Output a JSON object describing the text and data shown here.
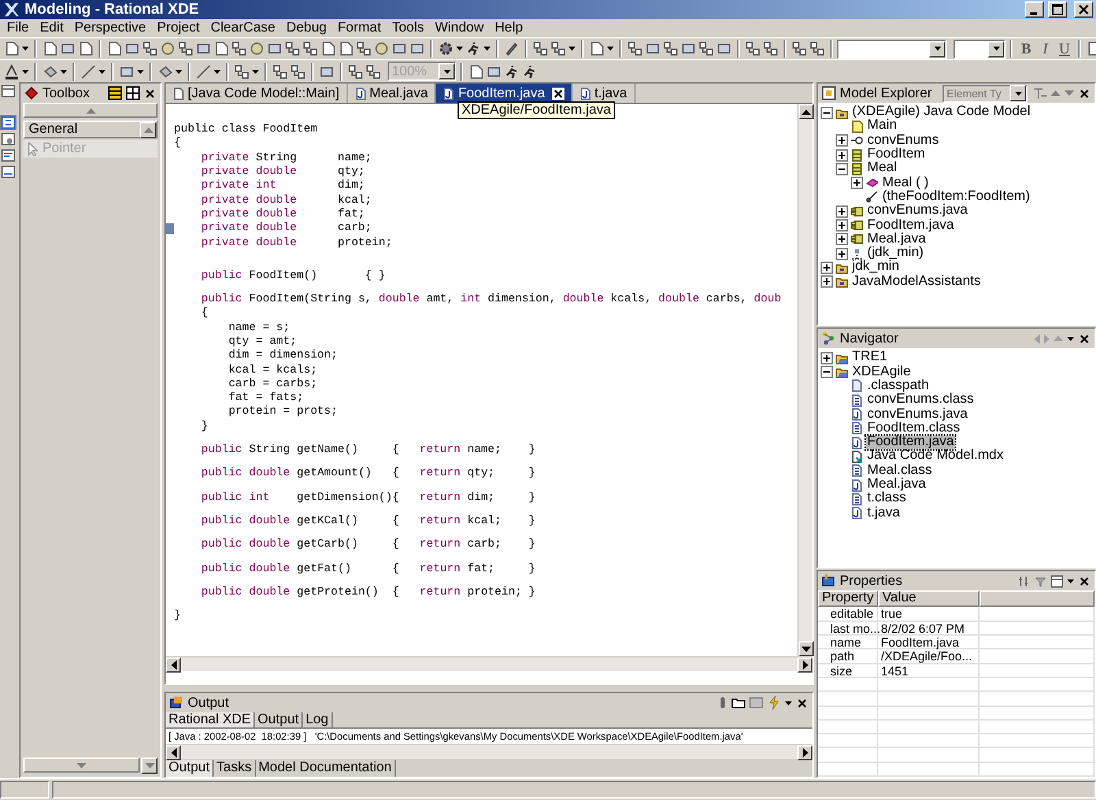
{
  "window": {
    "title": "Modeling - Rational XDE"
  },
  "menu": [
    "File",
    "Edit",
    "Perspective",
    "Project",
    "ClearCase",
    "Debug",
    "Format",
    "Tools",
    "Window",
    "Help"
  ],
  "toolbar": {
    "format_buttons": [
      "B",
      "I",
      "U"
    ],
    "zoom_combo": {
      "value": "100%",
      "disabled": true
    }
  },
  "toolbox": {
    "title": "Toolbox",
    "drawer": "General",
    "items": [
      {
        "label": "Pointer",
        "disabled": true
      }
    ]
  },
  "editor": {
    "tabs": [
      {
        "label": "[Java Code Model::Main]",
        "kind": "model",
        "selected": false
      },
      {
        "label": "Meal.java",
        "kind": "java",
        "selected": false
      },
      {
        "label": "FoodItem.java",
        "kind": "java",
        "selected": true
      },
      {
        "label": "t.java",
        "kind": "java",
        "selected": false
      }
    ],
    "tooltip": "XDEAgile/FoodItem.java",
    "lines": [
      {
        "bookmarked": false,
        "tokens": [
          {
            "kind": "plain",
            "text": "public class FoodItem"
          }
        ]
      },
      {
        "bookmarked": false,
        "tokens": [
          {
            "kind": "plain",
            "text": "{"
          }
        ]
      },
      {
        "bookmarked": false,
        "tokens": [
          {
            "kind": "keyword",
            "text": "    private"
          },
          {
            "kind": "plain",
            "text": " String      name;"
          }
        ]
      },
      {
        "bookmarked": false,
        "tokens": [
          {
            "kind": "keyword",
            "text": "    private double"
          },
          {
            "kind": "plain",
            "text": "      qty;"
          }
        ]
      },
      {
        "bookmarked": false,
        "tokens": [
          {
            "kind": "keyword",
            "text": "    private int"
          },
          {
            "kind": "plain",
            "text": "         dim;"
          }
        ]
      },
      {
        "bookmarked": false,
        "tokens": [
          {
            "kind": "keyword",
            "text": "    private double"
          },
          {
            "kind": "plain",
            "text": "      kcal;"
          }
        ]
      },
      {
        "bookmarked": false,
        "tokens": [
          {
            "kind": "keyword",
            "text": "    private double"
          },
          {
            "kind": "plain",
            "text": "      fat;"
          }
        ]
      },
      {
        "bookmarked": true,
        "tokens": [
          {
            "kind": "keyword",
            "text": "    private double"
          },
          {
            "kind": "plain",
            "text": "      carb;"
          }
        ]
      },
      {
        "bookmarked": false,
        "tokens": [
          {
            "kind": "keyword",
            "text": "    private double"
          },
          {
            "kind": "plain",
            "text": "      protein;"
          }
        ]
      },
      {
        "bookmarked": false
      },
      {
        "bookmarked": false
      },
      {
        "bookmarked": false,
        "tokens": [
          {
            "kind": "keyword",
            "text": "    public"
          },
          {
            "kind": "plain",
            "text": " FoodItem()       { }"
          }
        ]
      },
      {
        "bookmarked": false
      },
      {
        "bookmarked": false,
        "tokens": [
          {
            "kind": "keyword",
            "text": "    public"
          },
          {
            "kind": "plain",
            "text": " FoodItem(String s, "
          },
          {
            "kind": "keyword",
            "text": "double"
          },
          {
            "kind": "plain",
            "text": " amt, "
          },
          {
            "kind": "keyword",
            "text": "int"
          },
          {
            "kind": "plain",
            "text": " dimension, "
          },
          {
            "kind": "keyword",
            "text": "double"
          },
          {
            "kind": "plain",
            "text": " kcals, "
          },
          {
            "kind": "keyword",
            "text": "double"
          },
          {
            "kind": "plain",
            "text": " carbs, "
          },
          {
            "kind": "keyword",
            "text": "doub"
          }
        ]
      },
      {
        "bookmarked": false,
        "tokens": [
          {
            "kind": "plain",
            "text": "    {"
          }
        ]
      },
      {
        "bookmarked": false,
        "tokens": [
          {
            "kind": "plain",
            "text": "        name = s;"
          }
        ]
      },
      {
        "bookmarked": false,
        "tokens": [
          {
            "kind": "plain",
            "text": "        qty = amt;"
          }
        ]
      },
      {
        "bookmarked": false,
        "tokens": [
          {
            "kind": "plain",
            "text": "        dim = dimension;"
          }
        ]
      },
      {
        "bookmarked": false,
        "tokens": [
          {
            "kind": "plain",
            "text": "        kcal = kcals;"
          }
        ]
      },
      {
        "bookmarked": false,
        "tokens": [
          {
            "kind": "plain",
            "text": "        carb = carbs;"
          }
        ]
      },
      {
        "bookmarked": false,
        "tokens": [
          {
            "kind": "plain",
            "text": "        fat = fats;"
          }
        ]
      },
      {
        "bookmarked": false,
        "tokens": [
          {
            "kind": "plain",
            "text": "        protein = prots;"
          }
        ]
      },
      {
        "bookmarked": false,
        "tokens": [
          {
            "kind": "plain",
            "text": "    }"
          }
        ]
      },
      {
        "bookmarked": false
      },
      {
        "bookmarked": false,
        "tokens": [
          {
            "kind": "keyword",
            "text": "    public"
          },
          {
            "kind": "plain",
            "text": " String getName()     {   "
          },
          {
            "kind": "keyword",
            "text": "return"
          },
          {
            "kind": "plain",
            "text": " name;    }"
          }
        ]
      },
      {
        "bookmarked": false
      },
      {
        "bookmarked": false,
        "tokens": [
          {
            "kind": "keyword",
            "text": "    public double"
          },
          {
            "kind": "plain",
            "text": " getAmount()   {   "
          },
          {
            "kind": "keyword",
            "text": "return"
          },
          {
            "kind": "plain",
            "text": " qty;     }"
          }
        ]
      },
      {
        "bookmarked": false
      },
      {
        "bookmarked": false,
        "tokens": [
          {
            "kind": "keyword",
            "text": "    public int"
          },
          {
            "kind": "plain",
            "text": "    getDimension(){   "
          },
          {
            "kind": "keyword",
            "text": "return"
          },
          {
            "kind": "plain",
            "text": " dim;     }"
          }
        ]
      },
      {
        "bookmarked": false
      },
      {
        "bookmarked": false,
        "tokens": [
          {
            "kind": "keyword",
            "text": "    public double"
          },
          {
            "kind": "plain",
            "text": " getKCal()     {   "
          },
          {
            "kind": "keyword",
            "text": "return"
          },
          {
            "kind": "plain",
            "text": " kcal;    }"
          }
        ]
      },
      {
        "bookmarked": false
      },
      {
        "bookmarked": false,
        "tokens": [
          {
            "kind": "keyword",
            "text": "    public double"
          },
          {
            "kind": "plain",
            "text": " getCarb()     {   "
          },
          {
            "kind": "keyword",
            "text": "return"
          },
          {
            "kind": "plain",
            "text": " carb;    }"
          }
        ]
      },
      {
        "bookmarked": false
      },
      {
        "bookmarked": false,
        "tokens": [
          {
            "kind": "keyword",
            "text": "    public double"
          },
          {
            "kind": "plain",
            "text": " getFat()      {   "
          },
          {
            "kind": "keyword",
            "text": "return"
          },
          {
            "kind": "plain",
            "text": " fat;     }"
          }
        ]
      },
      {
        "bookmarked": false
      },
      {
        "bookmarked": false,
        "tokens": [
          {
            "kind": "keyword",
            "text": "    public double"
          },
          {
            "kind": "plain",
            "text": " getProtein()  {   "
          },
          {
            "kind": "keyword",
            "text": "return"
          },
          {
            "kind": "plain",
            "text": " protein; }"
          }
        ]
      },
      {
        "bookmarked": false
      },
      {
        "bookmarked": false,
        "tokens": [
          {
            "kind": "plain",
            "text": "}"
          }
        ]
      }
    ]
  },
  "output": {
    "title": "Output",
    "tabs": [
      {
        "label": "Rational XDE",
        "selected": true
      },
      {
        "label": "Output",
        "selected": false
      },
      {
        "label": "Log",
        "selected": false
      }
    ],
    "lines": [
      "[ Java : 2002-08-02  18:02:39 ]   'C:\\Documents and Settings\\gkevans\\My Documents\\XDE Workspace\\XDEAgile\\FoodItem.java'"
    ],
    "bottom_tabs": [
      {
        "label": "Output",
        "selected": true
      },
      {
        "label": "Tasks",
        "selected": false
      },
      {
        "label": "Model Documentation",
        "selected": false
      }
    ]
  },
  "model_explorer": {
    "title": "Model Explorer",
    "filter": {
      "value": "Element Ty",
      "disabled": true
    },
    "tree": [
      {
        "label": "(XDEAgile) Java Code Model",
        "kind": "model",
        "expandable": true,
        "expanded": true,
        "selected": false,
        "children": [
          {
            "label": "Main",
            "kind": "note",
            "expandable": false,
            "expanded": false,
            "selected": false
          },
          {
            "label": "convEnums",
            "kind": "interface",
            "expandable": true,
            "expanded": false,
            "selected": false
          },
          {
            "label": "FoodItem",
            "kind": "class",
            "expandable": true,
            "expanded": false,
            "selected": false
          },
          {
            "label": "Meal",
            "kind": "class",
            "expandable": true,
            "expanded": true,
            "selected": false,
            "children": [
              {
                "label": "Meal ( )",
                "kind": "operation",
                "expandable": true,
                "expanded": false,
                "selected": false
              },
              {
                "label": "(theFoodItem:FoodItem)",
                "kind": "association",
                "expandable": false,
                "expanded": false,
                "selected": false
              }
            ]
          },
          {
            "label": "convEnums.java",
            "kind": "component",
            "expandable": true,
            "expanded": false,
            "selected": false
          },
          {
            "label": "FoodItem.java",
            "kind": "component",
            "expandable": true,
            "expanded": false,
            "selected": false
          },
          {
            "label": "Meal.java",
            "kind": "component",
            "expandable": true,
            "expanded": false,
            "selected": false
          },
          {
            "label": "(jdk_min)",
            "kind": "dependency",
            "expandable": true,
            "expanded": false,
            "selected": false
          }
        ]
      },
      {
        "label": "jdk_min",
        "kind": "model",
        "expandable": true,
        "expanded": false,
        "selected": false
      },
      {
        "label": "JavaModelAssistants",
        "kind": "model",
        "expandable": true,
        "expanded": false,
        "selected": false
      }
    ]
  },
  "navigator": {
    "title": "Navigator",
    "tree": [
      {
        "label": "TRE1",
        "kind": "project",
        "expandable": true,
        "expanded": false,
        "selected": false
      },
      {
        "label": "XDEAgile",
        "kind": "project",
        "expandable": true,
        "expanded": true,
        "selected": false,
        "children": [
          {
            "label": ".classpath",
            "kind": "file",
            "expandable": false,
            "expanded": false,
            "selected": false
          },
          {
            "label": "convEnums.class",
            "kind": "classfile",
            "expandable": false,
            "expanded": false,
            "selected": false
          },
          {
            "label": "convEnums.java",
            "kind": "javafile",
            "expandable": false,
            "expanded": false,
            "selected": false
          },
          {
            "label": "FoodItem.class",
            "kind": "classfile",
            "expandable": false,
            "expanded": false,
            "selected": false
          },
          {
            "label": "FoodItem.java",
            "kind": "javafile",
            "expandable": false,
            "expanded": false,
            "selected": true
          },
          {
            "label": "Java Code Model.mdx",
            "kind": "mdx",
            "expandable": false,
            "expanded": false,
            "selected": false
          },
          {
            "label": "Meal.class",
            "kind": "classfile",
            "expandable": false,
            "expanded": false,
            "selected": false
          },
          {
            "label": "Meal.java",
            "kind": "javafile",
            "expandable": false,
            "expanded": false,
            "selected": false
          },
          {
            "label": "t.class",
            "kind": "classfile",
            "expandable": false,
            "expanded": false,
            "selected": false
          },
          {
            "label": "t.java",
            "kind": "javafile",
            "expandable": false,
            "expanded": false,
            "selected": false
          }
        ]
      }
    ]
  },
  "properties": {
    "title": "Properties",
    "columns": [
      "Property",
      "Value"
    ],
    "rows": [
      {
        "property": "editable",
        "value": "true"
      },
      {
        "property": "last mo...",
        "value": "8/2/02 6:07 PM"
      },
      {
        "property": "name",
        "value": "FoodItem.java"
      },
      {
        "property": "path",
        "value": "/XDEAgile/Foo..."
      },
      {
        "property": "size",
        "value": "1451"
      }
    ]
  }
}
